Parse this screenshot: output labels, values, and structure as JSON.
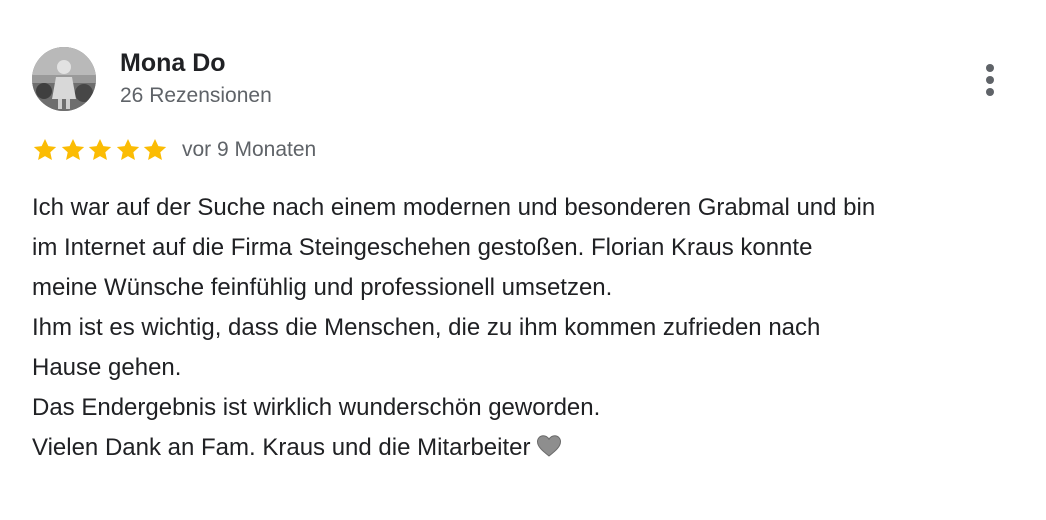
{
  "review": {
    "author_name": "Mona Do",
    "review_count": "26 Rezensionen",
    "rating": 5,
    "rating_max": 5,
    "star_color": "#fbbc04",
    "date": "vor 9 Monaten",
    "text_lines": [
      "Ich war auf der Suche nach einem modernen und besonderen Grabmal und bin",
      "im Internet auf die Firma Steingeschehen gestoßen. Florian Kraus konnte",
      "meine Wünsche feinfühlig und professionell umsetzen.",
      "Ihm ist es wichtig, dass die Menschen, die zu ihm kommen zufrieden nach",
      "Hause gehen.",
      "Das Endergebnis ist wirklich wunderschön geworden.",
      "Vielen Dank an Fam. Kraus und die Mitarbeiter"
    ],
    "emoji": "grey-heart-icon",
    "more_options_icon": "more-vert-icon"
  }
}
